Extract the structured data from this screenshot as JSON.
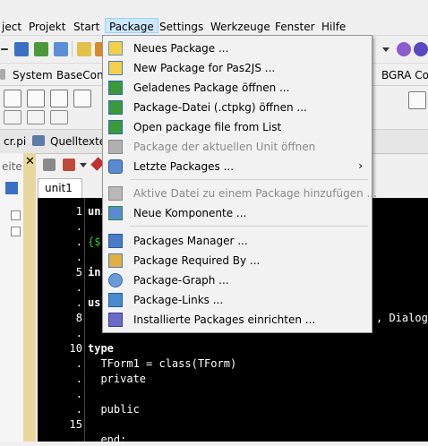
{
  "menubar": {
    "items": [
      "ject",
      "Projekt",
      "Start",
      "Package",
      "Settings",
      "Werkzeuge",
      "Fenster",
      "Hilfe"
    ],
    "active": "Package"
  },
  "palette_tabs": [
    "System",
    "BaseCont",
    "BGRA Cor"
  ],
  "editor_tabs": [
    "cr.pi",
    "Quelltexted"
  ],
  "side_label": "eite",
  "unit_tab": "unit1",
  "package_menu": {
    "items": [
      {
        "label": "Neues Package ...",
        "icon": "new-package-icon",
        "enabled": true
      },
      {
        "label": "New Package for Pas2JS ...",
        "icon": "new-pas2js-package-icon",
        "enabled": true
      },
      {
        "label": "Geladenes Package öffnen ...",
        "icon": "open-loaded-package-icon",
        "enabled": true
      },
      {
        "label": "Package-Datei (.ctpkg) öffnen ...",
        "icon": "open-package-file-icon",
        "enabled": true
      },
      {
        "label": "Open package file from List",
        "icon": "open-package-list-icon",
        "enabled": true
      },
      {
        "label": "Package der aktuellen Unit öffnen",
        "icon": "current-unit-package-icon",
        "enabled": false
      },
      {
        "label": "Letzte Packages ...",
        "icon": "recent-packages-icon",
        "enabled": true,
        "submenu": true
      },
      {
        "label": "Aktive Datei zu einem Package hinzufügen ...",
        "icon": "add-file-to-package-icon",
        "enabled": false
      },
      {
        "label": "Neue Komponente ...",
        "icon": "new-component-icon",
        "enabled": true
      },
      {
        "label": "Packages Manager ...",
        "icon": "packages-manager-icon",
        "enabled": true
      },
      {
        "label": "Package Required By ...",
        "icon": "package-required-by-icon",
        "enabled": true
      },
      {
        "label": "Package-Graph ...",
        "icon": "package-graph-icon",
        "enabled": true
      },
      {
        "label": "Package-Links ...",
        "icon": "package-links-icon",
        "enabled": true
      },
      {
        "label": "Installierte Packages einrichten ...",
        "icon": "install-packages-icon",
        "enabled": true
      }
    ],
    "submenu_arrow": "›"
  },
  "code": {
    "line_numbers": [
      "1",
      ".",
      ".",
      ".",
      "5",
      ".",
      ".",
      "8",
      ".",
      "10",
      ".",
      ".",
      ".",
      ".",
      "15",
      "."
    ],
    "lines": [
      "uni",
      "",
      "{$",
      "",
      "in",
      "",
      "us",
      ", Dialog",
      "",
      "type",
      "  TForm1 = class(TForm)",
      "  private",
      "",
      "  public",
      "",
      "  end;"
    ]
  },
  "colors": {
    "menu_highlight": "#cce8ff",
    "editor_background": "#000000",
    "editor_text": "#ffffff"
  }
}
